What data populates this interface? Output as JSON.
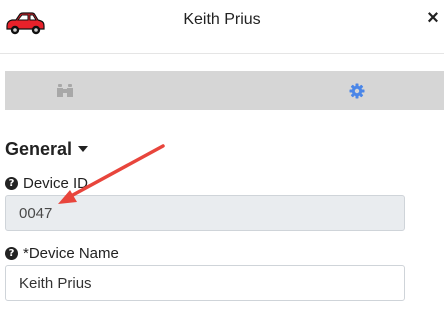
{
  "header": {
    "title": "Keith Prius",
    "close_glyph": "×",
    "car_icon": "red-car-icon"
  },
  "tabs": [
    {
      "icon": "binoculars-icon",
      "active": false
    },
    {
      "icon": "gear-icon",
      "active": true
    }
  ],
  "colors": {
    "tab_bar": "#d6d6d6",
    "active_tab_icon": "#4a86e8",
    "inactive_tab_icon": "#a8a8a8",
    "car_body": "#e8212a",
    "annotation_arrow": "#e8453c",
    "readonly_input_bg": "#e9ecef"
  },
  "section": {
    "title": "General"
  },
  "fields": {
    "device_id": {
      "label": "Device ID",
      "value": "0047",
      "readonly": true
    },
    "device_name": {
      "label": "*Device Name",
      "value": "Keith Prius"
    }
  }
}
